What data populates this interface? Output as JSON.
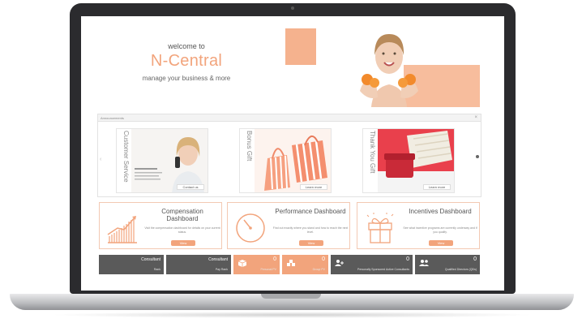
{
  "hero": {
    "welcome": "welcome to",
    "brand": "N-Central",
    "tagline": "manage your business & more"
  },
  "announcements": {
    "label": "Announcements",
    "close": "×",
    "cards": [
      {
        "title": "Customer Service",
        "button": "Contact us"
      },
      {
        "title": "Bonus Gift",
        "button": "Learn more"
      },
      {
        "title": "Thank You Gift",
        "button": "Learn more"
      }
    ],
    "dots": "• • •"
  },
  "dashboards": [
    {
      "title": "Compensation Dashboard",
      "desc": "Visit the compensation dashboard for details on your current status.",
      "button": "View"
    },
    {
      "title": "Performance Dashboard",
      "desc": "Find out exactly where you stand and how to reach the next level.",
      "button": "View"
    },
    {
      "title": "Incentives Dashboard",
      "desc": "See what incentive programs are currently underway and if you qualify.",
      "button": "View"
    }
  ],
  "tiles": [
    {
      "name": "Consultant",
      "sub": "Rank"
    },
    {
      "name": "Consultant",
      "sub": "Pay Rank"
    },
    {
      "value": "0",
      "sub": "Personal PV"
    },
    {
      "value": "0",
      "sub": "Group PV"
    },
    {
      "value": "0",
      "sub": "Personally Sponsored Active Consultants"
    },
    {
      "value": "0",
      "sub": "Qualified Directors (QDs)"
    }
  ],
  "colors": {
    "accent": "#f2a47c",
    "dark_tile": "#5a5a5a",
    "bezel": "#2b2b2e"
  }
}
